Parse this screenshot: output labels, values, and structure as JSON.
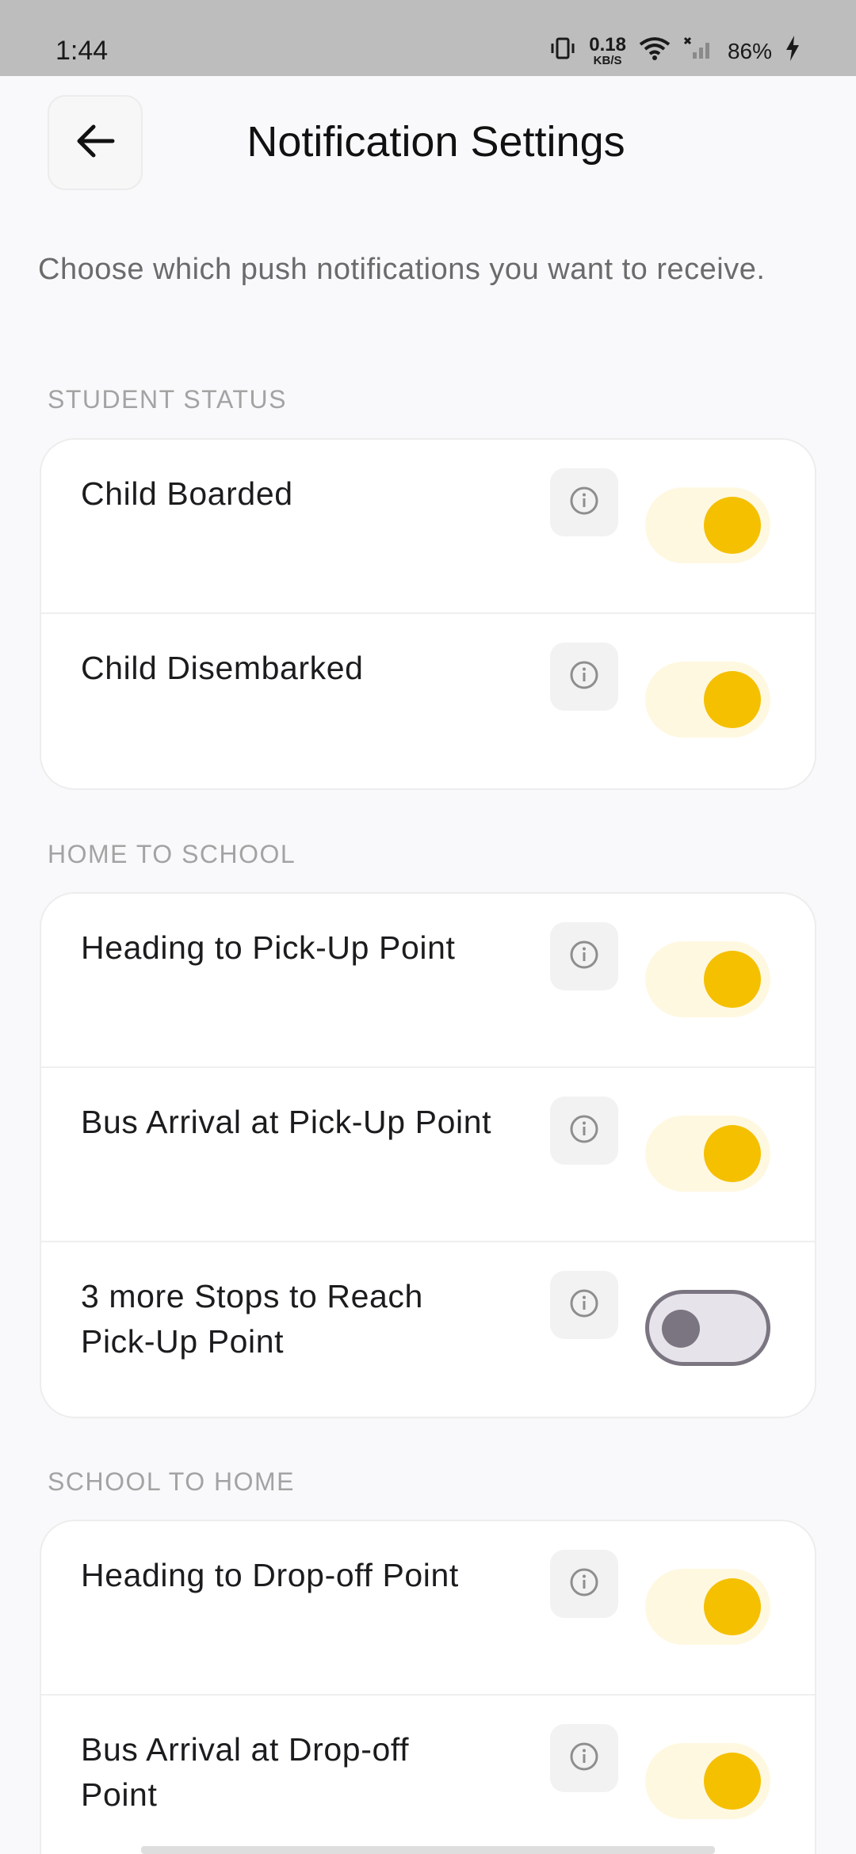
{
  "status_bar": {
    "time": "1:44",
    "net_speed_value": "0.18",
    "net_speed_unit": "KB/S",
    "battery": "86%"
  },
  "header": {
    "title": "Notification Settings"
  },
  "intro": "Choose which push notifications you want to receive.",
  "sections": [
    {
      "label": "STUDENT STATUS",
      "items": [
        {
          "label": "Child Boarded",
          "enabled": true
        },
        {
          "label": "Child Disembarked",
          "enabled": true
        }
      ]
    },
    {
      "label": "HOME TO SCHOOL",
      "items": [
        {
          "label": "Heading to Pick-Up Point",
          "enabled": true
        },
        {
          "label": "Bus Arrival at Pick-Up Point",
          "enabled": true
        },
        {
          "label": "3 more Stops to Reach Pick-Up Point",
          "enabled": false
        }
      ]
    },
    {
      "label": "SCHOOL TO HOME",
      "items": [
        {
          "label": "Heading to Drop-off Point",
          "enabled": true
        },
        {
          "label": "Bus Arrival at Drop-off Point",
          "enabled": true
        }
      ]
    }
  ],
  "colors": {
    "accent": "#F5C000",
    "toggle_on_track": "#FFF8E1",
    "toggle_off_track": "#E7E3EA",
    "toggle_off_border": "#7A7580"
  }
}
